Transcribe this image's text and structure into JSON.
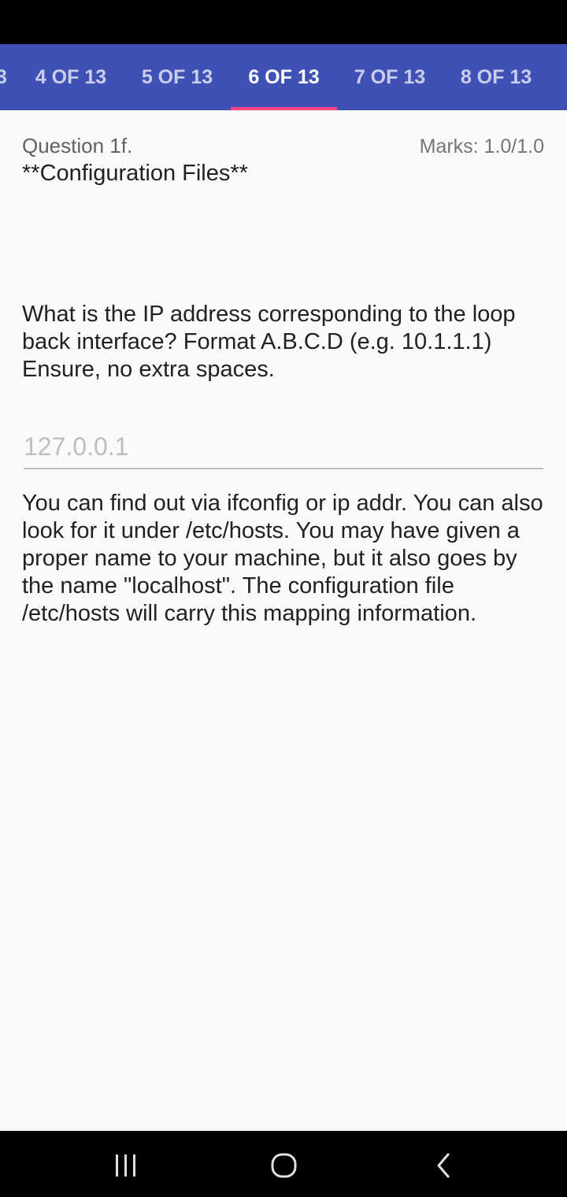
{
  "tabs": [
    {
      "label": "4 OF 13",
      "active": false
    },
    {
      "label": "5 OF 13",
      "active": false
    },
    {
      "label": "6 OF 13",
      "active": true
    },
    {
      "label": "7 OF 13",
      "active": false
    },
    {
      "label": "8 OF 13",
      "active": false
    }
  ],
  "colors": {
    "tab_bar": "#3f51b5",
    "tab_indicator": "#ff4081"
  },
  "question": {
    "number": "Question 1f.",
    "marks": "Marks: 1.0/1.0",
    "title": "**Configuration Files**",
    "text": "What is the IP address corresponding to the loop back interface? Format A.B.C.D (e.g. 10.1.1.1) Ensure, no extra spaces.",
    "answer_value": "127.0.0.1",
    "feedback": "You can find out via ifconfig or ip addr. You can also look for it under /etc/hosts. You may have given a proper name to your machine, but it also goes by the name \"localhost\". The configuration file /etc/hosts will carry this mapping information."
  },
  "nav_bar": {
    "icons": [
      "recent-apps-icon",
      "home-icon",
      "back-icon"
    ]
  }
}
